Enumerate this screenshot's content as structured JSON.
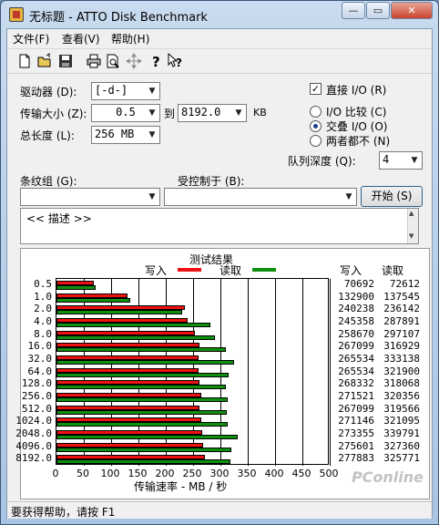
{
  "window": {
    "title": "无标题 - ATTO Disk Benchmark",
    "minimize": "—",
    "maximize": "▭",
    "close": "✕"
  },
  "menu": [
    "文件(F)",
    "查看(V)",
    "帮助(H)"
  ],
  "toolbar_icons": [
    "new-icon",
    "open-icon",
    "save-icon",
    "print-icon",
    "print-preview-icon",
    "move-icon",
    "help-icon",
    "context-help-icon"
  ],
  "form": {
    "drive_label": "驱动器 (D):",
    "drive_value": "[-d-]",
    "transfer_label": "传输大小 (Z):",
    "transfer_from": "0.5",
    "to_label": "到",
    "transfer_to": "8192.0",
    "kb_unit": "KB",
    "length_label": "总长度 (L):",
    "length_value": "256 MB",
    "direct_io_label": "直接 I/O (R)",
    "direct_io_checked": "✓",
    "io_compare_label": "I/O 比较 (C)",
    "overlap_io_label": "交叠 I/O (O)",
    "neither_label": "两者都不 (N)",
    "queue_label": "队列深度 (Q):",
    "queue_value": "4",
    "stripe_label": "条纹组 (G):",
    "control_label": "受控制于 (B):",
    "start_button": "开始 (S)",
    "description": "<< 描述 >>"
  },
  "results": {
    "title": "测试结果",
    "write_legend": "写入",
    "read_legend": "读取",
    "write_col": "写入",
    "read_col": "读取",
    "xaxis_label": "传输速率 - MB / 秒"
  },
  "chart_data": {
    "type": "bar",
    "orientation": "horizontal",
    "categories": [
      "0.5",
      "1.0",
      "2.0",
      "4.0",
      "8.0",
      "16.0",
      "32.0",
      "64.0",
      "128.0",
      "256.0",
      "512.0",
      "1024.0",
      "2048.0",
      "4096.0",
      "8192.0"
    ],
    "series": [
      {
        "name": "写入",
        "values": [
          70692,
          132900,
          240238,
          245358,
          258670,
          267099,
          265534,
          265534,
          268332,
          271521,
          267099,
          271146,
          273355,
          275601,
          277883
        ]
      },
      {
        "name": "读取",
        "values": [
          72612,
          137545,
          236142,
          287891,
          297107,
          316929,
          333138,
          321900,
          318068,
          320356,
          319566,
          321095,
          339791,
          327360,
          325771
        ]
      }
    ],
    "xlim": [
      0,
      500
    ],
    "xticks": [
      0,
      50,
      100,
      150,
      200,
      250,
      300,
      350,
      400,
      450,
      500
    ],
    "xlabel": "传输速率 - MB / 秒",
    "colors": {
      "write": "#ee1111",
      "read": "#0f8f0f"
    }
  },
  "status_bar": "要获得帮助，请按 F1",
  "watermark": "PConline"
}
